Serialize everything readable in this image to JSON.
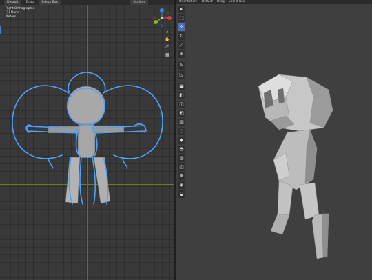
{
  "left_header": {
    "mode": "Default",
    "drag_label": "Drag",
    "select_label": "Select Box",
    "options_label": "Options"
  },
  "viewport_info": {
    "view": "Right Orthographic",
    "object": "(1) Plane",
    "units": "Meters"
  },
  "right_header": {
    "orientation_label": "Orientation:",
    "orientation_value": "Default",
    "drag_label": "Drag",
    "select_label": "Select Box"
  },
  "colors": {
    "gizmo_x": "#e0394b",
    "gizmo_y": "#7fbf2a",
    "gizmo_z": "#3b86de",
    "grease_pencil": "#4aa3ff",
    "active_tool": "#4a72b3"
  },
  "nav_tools": [
    {
      "icon": "zoom-icon",
      "glyph": "⌕"
    },
    {
      "icon": "hand-pan-icon",
      "glyph": "✋"
    },
    {
      "icon": "camera-icon",
      "glyph": "⎚"
    },
    {
      "icon": "grid-icon",
      "glyph": "▦"
    }
  ],
  "tools": [
    {
      "icon": "cursor-icon",
      "glyph": "▸",
      "active": false
    },
    {
      "icon": "select-box-icon",
      "glyph": "⬚",
      "active": false
    },
    {
      "icon": "move-icon",
      "glyph": "✛",
      "active": true
    },
    {
      "icon": "rotate-icon",
      "glyph": "↻",
      "active": false
    },
    {
      "icon": "scale-icon",
      "glyph": "⤢",
      "active": false
    },
    {
      "icon": "transform-icon",
      "glyph": "⊕",
      "active": false
    },
    {
      "icon": "annotate-icon",
      "glyph": "✎",
      "active": false
    },
    {
      "icon": "measure-icon",
      "glyph": "◺",
      "active": false
    },
    {
      "icon": "add-cube-icon",
      "glyph": "▣",
      "active": false
    },
    {
      "icon": "extrude-icon",
      "glyph": "◧",
      "active": false
    },
    {
      "icon": "inset-icon",
      "glyph": "◫",
      "active": false
    },
    {
      "icon": "bevel-icon",
      "glyph": "◩",
      "active": false
    },
    {
      "icon": "loop-cut-icon",
      "glyph": "▥",
      "active": false
    },
    {
      "icon": "knife-icon",
      "glyph": "◇",
      "active": false
    },
    {
      "icon": "poly-build-icon",
      "glyph": "◆",
      "active": false
    },
    {
      "icon": "spin-icon",
      "glyph": "◓",
      "active": false
    },
    {
      "icon": "smooth-icon",
      "glyph": "◍",
      "active": false
    },
    {
      "icon": "edge-slide-icon",
      "glyph": "◰",
      "active": false
    },
    {
      "icon": "shrink-fatten-icon",
      "glyph": "✥",
      "active": false
    },
    {
      "icon": "shear-icon",
      "glyph": "◈",
      "active": false
    },
    {
      "icon": "rip-region-icon",
      "glyph": "◒",
      "active": false
    }
  ]
}
